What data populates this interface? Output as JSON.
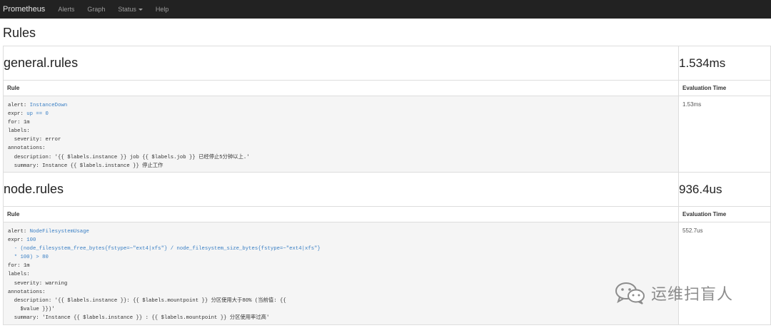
{
  "navbar": {
    "brand": "Prometheus",
    "links": [
      "Alerts",
      "Graph",
      "Status",
      "Help"
    ]
  },
  "page_title": "Rules",
  "table": {
    "col_rule": "Rule",
    "col_eval": "Evaluation Time"
  },
  "groups": [
    {
      "name": "general.rules",
      "eval_time": "1.534ms",
      "rule_eval_time": "1.53ms",
      "lines": [
        {
          "k": "alert: ",
          "v": "InstanceDown"
        },
        {
          "k": "expr: ",
          "v": "up == 0"
        },
        {
          "k": "for: 1m",
          "v": ""
        },
        {
          "k": "labels:",
          "v": ""
        },
        {
          "k": "  severity: error",
          "v": ""
        },
        {
          "k": "annotations:",
          "v": ""
        },
        {
          "k": "  description: '{{ $labels.instance }} job {{ $labels.job }} 已经停止5分钟以上.'",
          "v": ""
        },
        {
          "k": "  summary: Instance {{ $labels.instance }} 停止工作",
          "v": ""
        }
      ]
    },
    {
      "name": "node.rules",
      "eval_time": "936.4us",
      "rule_eval_time": "552.7us",
      "lines": [
        {
          "k": "alert: ",
          "v": "NodeFilesystemUsage"
        },
        {
          "k": "expr: ",
          "v": "100"
        },
        {
          "k": "",
          "v": "  - (node_filesystem_free_bytes{fstype=~\"ext4|xfs\"} / node_filesystem_size_bytes{fstype=~\"ext4|xfs\"}"
        },
        {
          "k": "",
          "v": "  * 100) > 80"
        },
        {
          "k": "for: 1m",
          "v": ""
        },
        {
          "k": "labels:",
          "v": ""
        },
        {
          "k": "  severity: warning",
          "v": ""
        },
        {
          "k": "annotations:",
          "v": ""
        },
        {
          "k": "  description: '{{ $labels.instance }}: {{ $labels.mountpoint }} 分区使用大于80% (当前值: {{",
          "v": ""
        },
        {
          "k": "    $value }})'",
          "v": ""
        },
        {
          "k": "  summary: 'Instance {{ $labels.instance }} : {{ $labels.mountpoint }} 分区使用率过高'",
          "v": ""
        }
      ]
    }
  ],
  "watermark": {
    "text": "运维扫盲人",
    "icon": "wechat-icon"
  }
}
